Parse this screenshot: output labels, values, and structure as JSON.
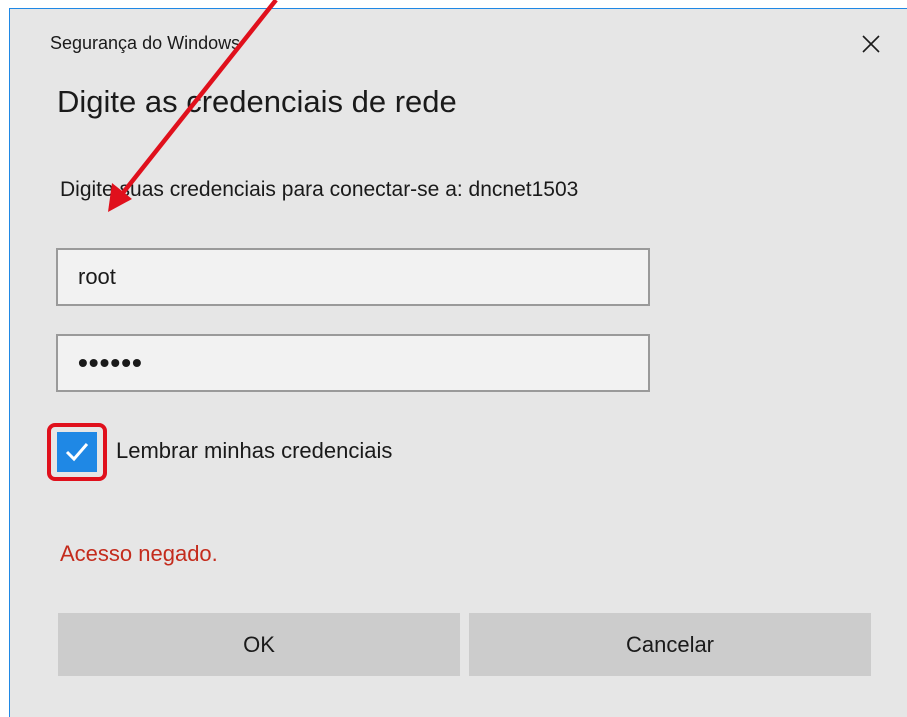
{
  "window": {
    "title": "Segurança do Windows",
    "close_icon": "close-icon"
  },
  "dialog": {
    "heading": "Digite as credenciais de rede",
    "subtext": "Digite suas credenciais para conectar-se a: dncnet1503"
  },
  "fields": {
    "username_value": "root",
    "password_value": "••••••"
  },
  "remember": {
    "label": "Lembrar minhas credenciais",
    "checked": true
  },
  "error": {
    "message": "Acesso negado."
  },
  "buttons": {
    "ok_label": "OK",
    "cancel_label": "Cancelar"
  },
  "colors": {
    "accent": "#1f88e5",
    "dialog_background": "#e6e6e6",
    "error_text": "#c42b1c",
    "annotation_red": "#e0101c",
    "button_background": "#cccccc"
  }
}
